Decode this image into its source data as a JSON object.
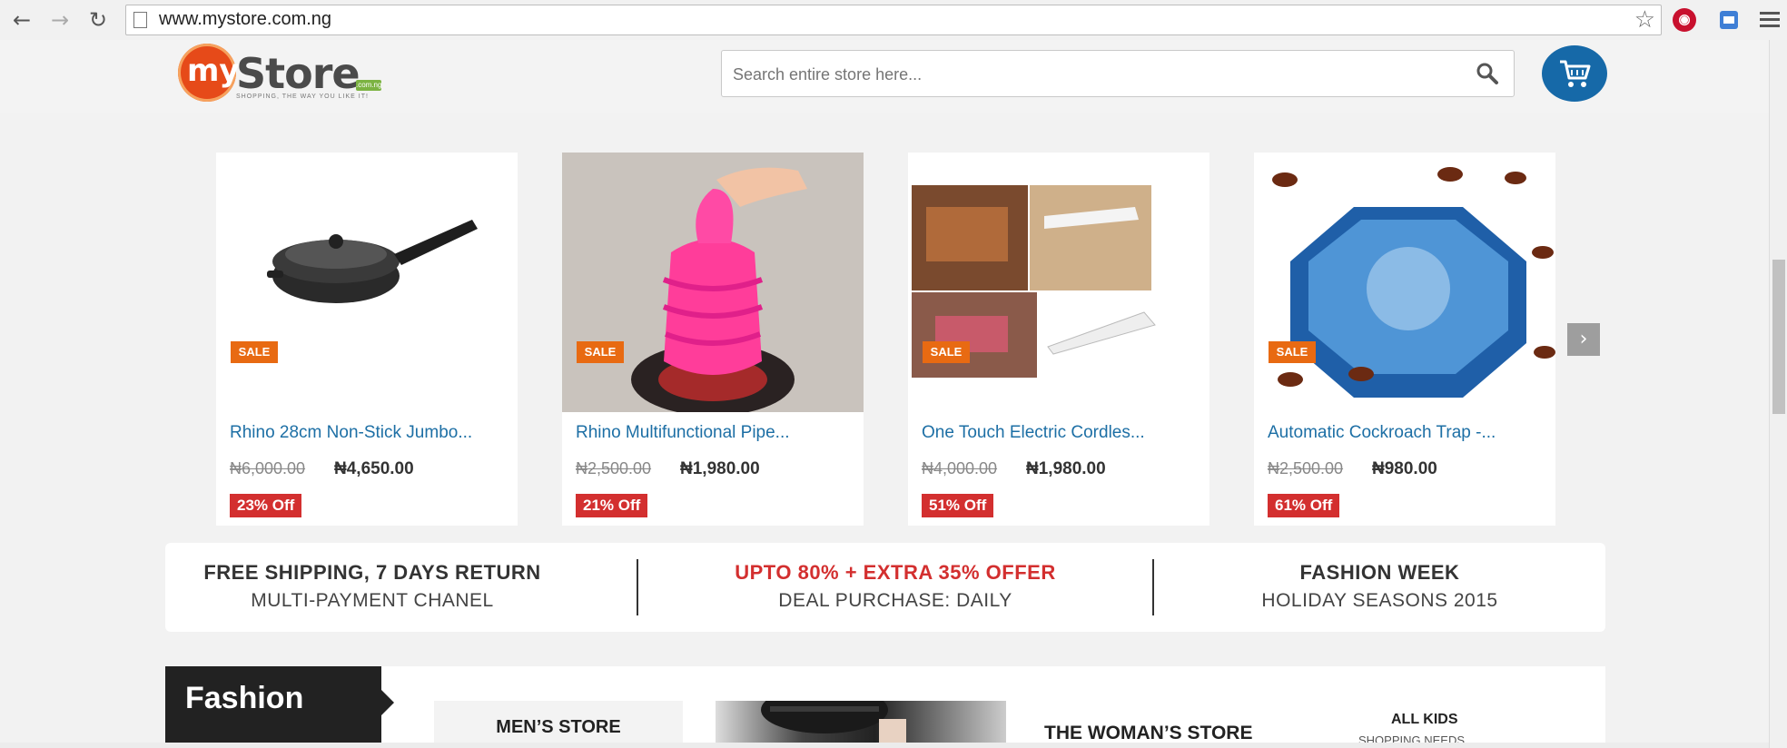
{
  "browser": {
    "url": "www.mystore.com.ng",
    "back_icon": "back-arrow-icon",
    "forward_icon": "forward-arrow-icon",
    "reload_icon": "reload-icon",
    "bookmark_icon": "star-icon",
    "menu_icon": "hamburger-menu-icon"
  },
  "header": {
    "logo_my": "my",
    "logo_store": "Store",
    "logo_tld": ".com.ng",
    "logo_tagline": "SHOPPING, THE WAY YOU LIKE IT!",
    "search_placeholder": "Search entire store here...",
    "cart_icon": "shopping-cart-icon",
    "accent_color": "#1669a8"
  },
  "products": [
    {
      "sale": "SALE",
      "name": "Rhino 28cm Non-Stick Jumbo...",
      "old_price": "₦6,000.00",
      "new_price": "₦4,650.00",
      "discount": "23% Off",
      "image": "frying-pan"
    },
    {
      "sale": "SALE",
      "name": "Rhino Multifunctional Pipe...",
      "old_price": "₦2,500.00",
      "new_price": "₦1,980.00",
      "discount": "21% Off",
      "image": "pink-plunger"
    },
    {
      "sale": "SALE",
      "name": "One Touch Electric Cordles...",
      "old_price": "₦4,000.00",
      "new_price": "₦1,980.00",
      "discount": "51% Off",
      "image": "electric-knife"
    },
    {
      "sale": "SALE",
      "name": "Automatic Cockroach Trap -...",
      "old_price": "₦2,500.00",
      "new_price": "₦980.00",
      "discount": "61% Off",
      "image": "cockroach-trap"
    }
  ],
  "promo": [
    {
      "line1": "FREE SHIPPING, 7 DAYS RETURN",
      "line2": "MULTI-PAYMENT CHANEL",
      "line1_color": "#333333"
    },
    {
      "line1": "UPTO 80% + EXTRA 35% OFFER",
      "line2": "DEAL PURCHASE: DAILY",
      "line1_color": "#d32f2f"
    },
    {
      "line1": "FASHION WEEK",
      "line2": "HOLIDAY SEASONS 2015",
      "line1_color": "#333333"
    }
  ],
  "fashion": {
    "title": "Fashion",
    "mens": "MEN’S STORE",
    "woman": "THE WOMAN’S STORE",
    "kids": "ALL KIDS",
    "kids_sub": "SHOPPING NEEDS"
  }
}
